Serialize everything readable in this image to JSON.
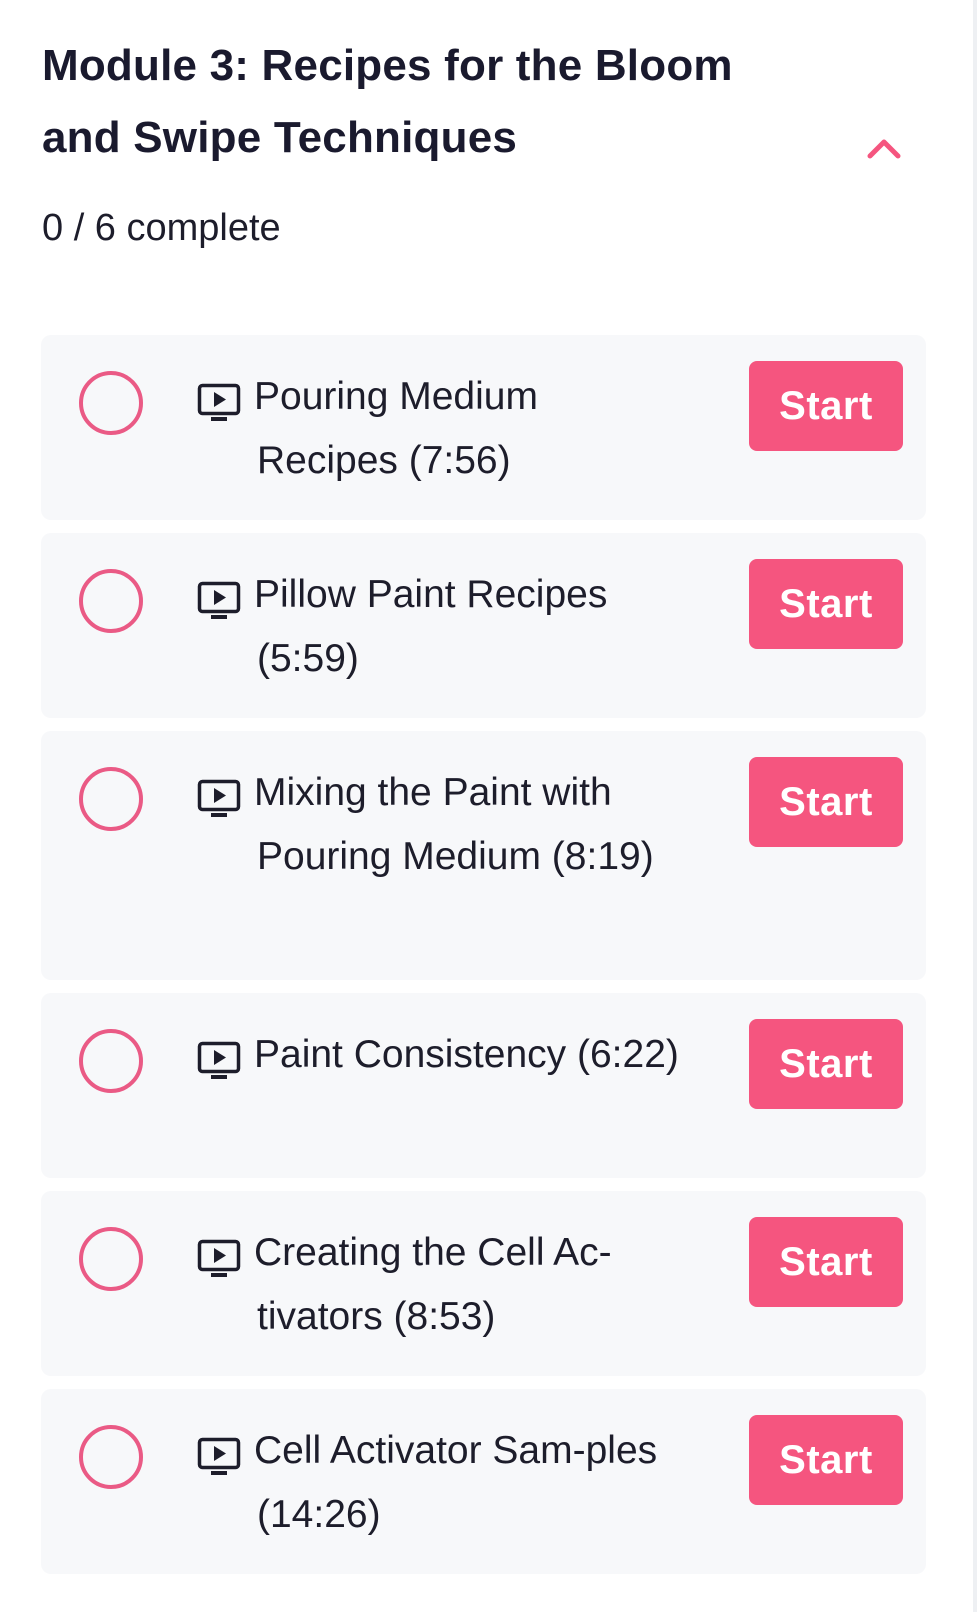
{
  "module": {
    "title": "Module 3: Recipes for the Bloom and Swipe Techniques",
    "progress": "0 / 6 complete",
    "completed_count": 0,
    "total_count": 6,
    "toggle_icon": "chevron-up-icon"
  },
  "colors": {
    "accent": "#f5557f",
    "circle_outline": "#ea5a85",
    "card_background": "#f7f8fa",
    "text": "#1d1d2b"
  },
  "lessons": [
    {
      "title": "Pouring Medium Recipes (7:56)",
      "button": "Start",
      "icon": "video-icon",
      "completed": false
    },
    {
      "title": "Pillow Paint Recipes (5:59)",
      "button": "Start",
      "icon": "video-icon",
      "completed": false
    },
    {
      "title": "Mixing the Paint with Pouring Medium (8:19)",
      "button": "Start",
      "icon": "video-icon",
      "completed": false
    },
    {
      "title": "Paint Consistency (6:22)",
      "button": "Start",
      "icon": "video-icon",
      "completed": false
    },
    {
      "title": "Creating the Cell Ac-tivators (8:53)",
      "button": "Start",
      "icon": "video-icon",
      "completed": false
    },
    {
      "title": "Cell Activator Sam-ples (14:26)",
      "button": "Start",
      "icon": "video-icon",
      "completed": false
    }
  ]
}
